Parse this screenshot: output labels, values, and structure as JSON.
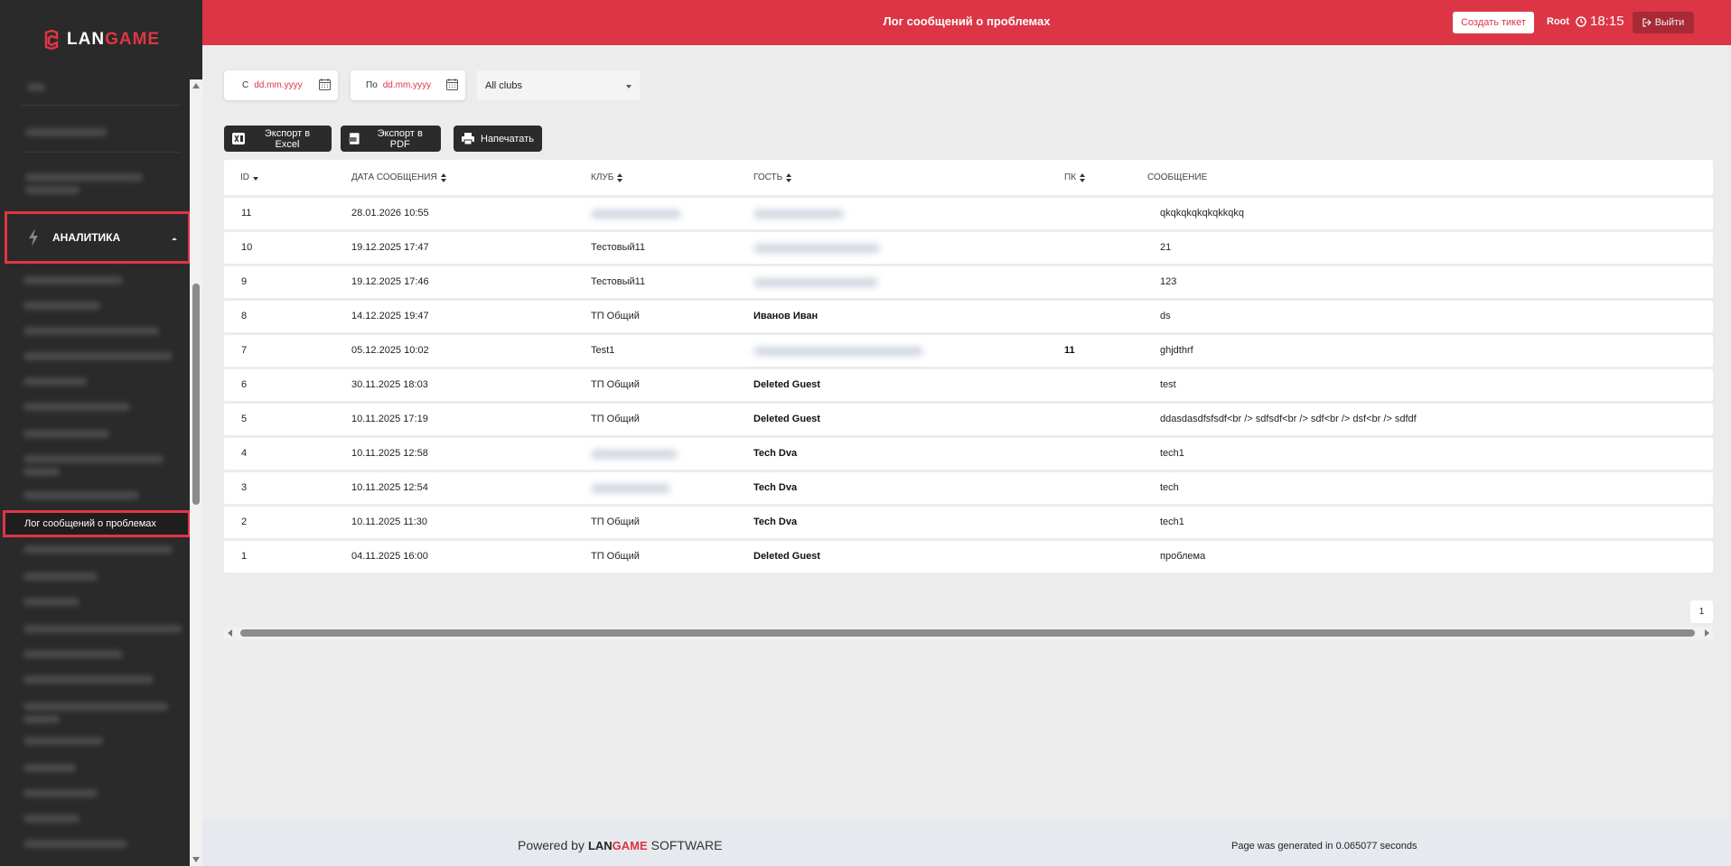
{
  "brand": {
    "lan": "LAN",
    "game": "GAME"
  },
  "header": {
    "title": "Лог сообщений о проблемах",
    "create_ticket": "Создать тикет",
    "user": "Root",
    "time": "18:15",
    "logout": "Выйти"
  },
  "sidebar": {
    "section": "АНАЛИТИКА",
    "active_item": "Лог сообщений о проблемах"
  },
  "filters": {
    "from_prefix": "С",
    "from_placeholder": "dd.mm.yyyy",
    "to_prefix": "По",
    "to_placeholder": "dd.mm.yyyy",
    "club": "All clubs"
  },
  "exports": {
    "excel": "Экспорт в Excel",
    "pdf": "Экспорт в PDF",
    "print": "Напечатать"
  },
  "table": {
    "columns": [
      "ID",
      "ДАТА СООБЩЕНИЯ",
      "КЛУБ",
      "ГОСТЬ",
      "ПК",
      "СООБЩЕНИЕ"
    ],
    "rows": [
      {
        "id": "11",
        "date": "28.01.2026 10:55",
        "club": "",
        "guest": "",
        "pc": "",
        "message": "qkqkqkqkqkqkkqkq"
      },
      {
        "id": "10",
        "date": "19.12.2025 17:47",
        "club": "Тестовый11",
        "guest": "",
        "pc": "",
        "message": "21"
      },
      {
        "id": "9",
        "date": "19.12.2025 17:46",
        "club": "Тестовый11",
        "guest": "",
        "pc": "",
        "message": "123"
      },
      {
        "id": "8",
        "date": "14.12.2025 19:47",
        "club": "ТП Общий",
        "guest": "Иванов Иван",
        "pc": "",
        "message": "ds"
      },
      {
        "id": "7",
        "date": "05.12.2025 10:02",
        "club": "Test1",
        "guest": "",
        "pc": "11",
        "message": "ghjdthrf"
      },
      {
        "id": "6",
        "date": "30.11.2025 18:03",
        "club": "ТП Общий",
        "guest": "Deleted Guest",
        "pc": "",
        "message": "test"
      },
      {
        "id": "5",
        "date": "10.11.2025 17:19",
        "club": "ТП Общий",
        "guest": "Deleted Guest",
        "pc": "",
        "message": "ddasdasdfsfsdf<br /> sdfsdf<br /> sdf<br /> dsf<br /> sdfdf"
      },
      {
        "id": "4",
        "date": "10.11.2025 12:58",
        "club": "",
        "guest": "Tech Dva",
        "pc": "",
        "message": "tech1"
      },
      {
        "id": "3",
        "date": "10.11.2025 12:54",
        "club": "",
        "guest": "Tech Dva",
        "pc": "",
        "message": "tech"
      },
      {
        "id": "2",
        "date": "10.11.2025 11:30",
        "club": "ТП Общий",
        "guest": "Tech Dva",
        "pc": "",
        "message": "tech1"
      },
      {
        "id": "1",
        "date": "04.11.2025 16:00",
        "club": "ТП Общий",
        "guest": "Deleted Guest",
        "pc": "",
        "message": "проблема"
      }
    ]
  },
  "pagination": {
    "current": "1"
  },
  "footer": {
    "powered_by": "Powered by",
    "lan": "LAN",
    "game": "GAME",
    "software": "SOFTWARE",
    "generated": "Page was generated in 0.065077 seconds"
  },
  "colors": {
    "accent": "#dc3545",
    "sidebar": "#2a2a2a",
    "dark_button": "#2b2b2b"
  }
}
